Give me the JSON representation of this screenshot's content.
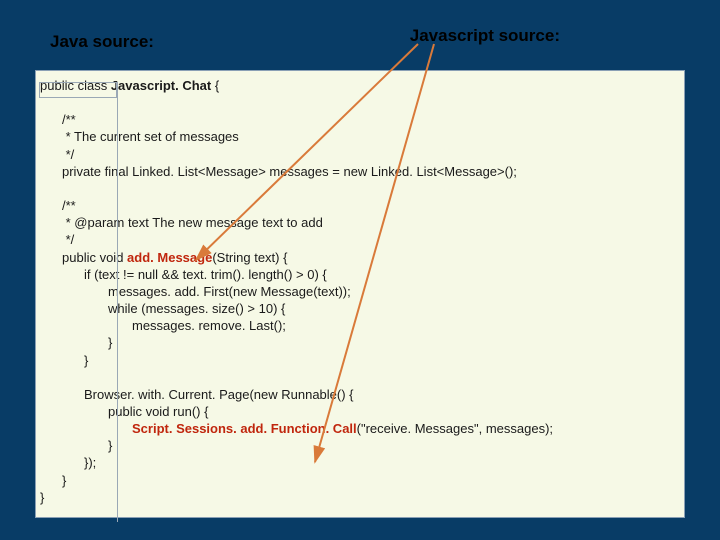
{
  "headers": {
    "left": "Java source:",
    "right": "Javascript source:"
  },
  "code": {
    "l01": "public class ",
    "l01b": "Javascript. Chat",
    "l01c": " {",
    "l02": "/**",
    "l03": " * The current set of messages",
    "l04": " */",
    "l05": "private final Linked. List<Message> messages = new Linked. List<Message>();",
    "l06": "/**",
    "l07": " * @param text The new message text to add",
    "l08": " */",
    "l09a": "public void ",
    "l09b": "add. Message",
    "l09c": "(String text) {",
    "l10": "if (text != null && text. trim(). length() > 0) {",
    "l11": "messages. add. First(new Message(text));",
    "l12": "while (messages. size() > 10) {",
    "l13": "messages. remove. Last();",
    "l14": "}",
    "l15": "}",
    "l16": "Browser. with. Current. Page(new Runnable() {",
    "l17": "public void run() {",
    "l18a": "Script. Sessions. add. Function. Call",
    "l18b": "(\"receive. Messages\", messages);",
    "l19": "}",
    "l20": "});",
    "l21": "}",
    "l22": "}"
  }
}
